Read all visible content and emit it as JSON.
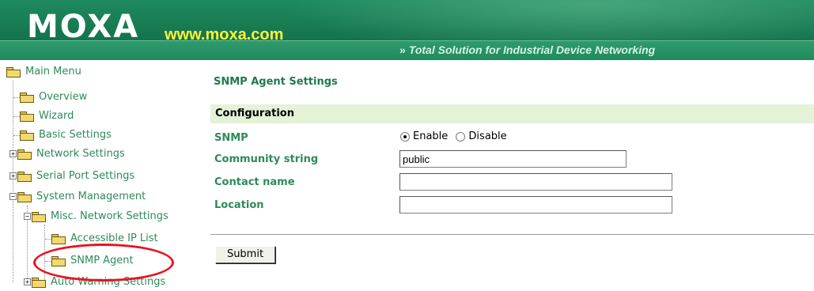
{
  "header": {
    "logo": "MOXA",
    "url": "www.moxa.com",
    "arrows": "»",
    "tagline": "Total Solution for Industrial Device Networking"
  },
  "menu": {
    "main": "Main Menu",
    "overview": "Overview",
    "wizard": "Wizard",
    "basic": "Basic Settings",
    "network": "Network Settings",
    "serial": "Serial Port Settings",
    "system": "System Management",
    "misc": "Misc. Network Settings",
    "accessible_ip": "Accessible IP List",
    "snmp_agent": "SNMP Agent",
    "auto_warning": "Auto Warning Settings",
    "expand_symbol": "+",
    "collapse_symbol": "−"
  },
  "page": {
    "title": "SNMP Agent Settings",
    "section": "Configuration",
    "snmp_label": "SNMP",
    "enable_label": "Enable",
    "disable_label": "Disable",
    "snmp_value": "Enable",
    "community_label": "Community string",
    "community_value": "public",
    "contact_label": "Contact name",
    "contact_value": "",
    "location_label": "Location",
    "location_value": "",
    "submit_label": "Submit"
  },
  "colors": {
    "banner": "#16774f",
    "url": "#fff23a",
    "menu_text": "#2f8a5a",
    "section_bar": "#e4f2d8",
    "highlight": "#e8141e"
  }
}
